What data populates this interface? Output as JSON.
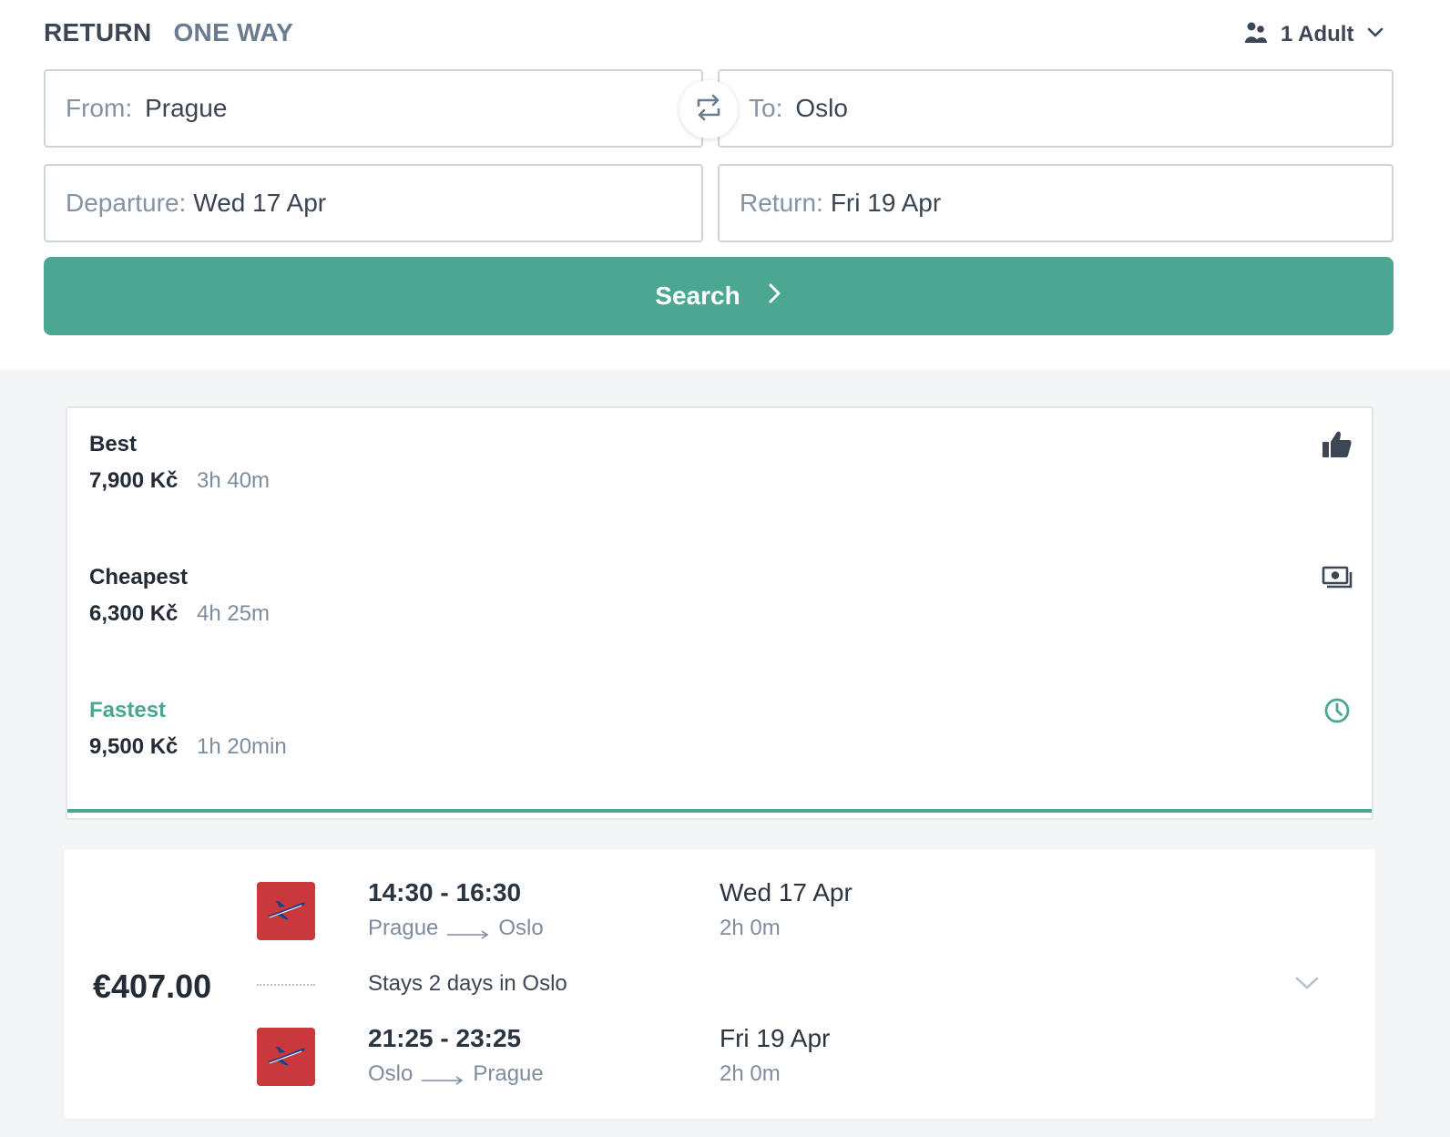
{
  "trip_type": {
    "return_label": "RETURN",
    "oneway_label": "ONE WAY",
    "selected": "RETURN"
  },
  "passengers": {
    "label": "1 Adult",
    "icon": "users-icon"
  },
  "search_form": {
    "from_label": "From:",
    "from_value": "Prague",
    "to_label": "To:",
    "to_value": "Oslo",
    "departure_label": "Departure:",
    "departure_value": "Wed 17 Apr",
    "return_label": "Return:",
    "return_value": "Fri 19 Apr",
    "search_button": "Search"
  },
  "sort_options": [
    {
      "title": "Best",
      "price": "7,900 Kč",
      "duration": "3h 40m",
      "icon": "thumbs-up-icon",
      "active": false
    },
    {
      "title": "Cheapest",
      "price": "6,300 Kč",
      "duration": "4h 25m",
      "icon": "money-icon",
      "active": false
    },
    {
      "title": "Fastest",
      "price": "9,500 Kč",
      "duration": "1h 20min",
      "icon": "clock-icon",
      "active": true
    }
  ],
  "result": {
    "price": "€407.00",
    "outbound": {
      "times": "14:30 - 16:30",
      "from": "Prague",
      "to": "Oslo",
      "date": "Wed 17 Apr",
      "duration": "2h 0m"
    },
    "stay_text": "Stays 2 days in Oslo",
    "inbound": {
      "times": "21:25 - 23:25",
      "from": "Oslo",
      "to": "Prague",
      "date": "Fri 19 Apr",
      "duration": "2h 0m"
    }
  },
  "colors": {
    "accent": "#4ba692",
    "airline_logo_bg": "#c9383a",
    "muted_text": "#7e8ca0",
    "dark_text": "#2b3542"
  }
}
